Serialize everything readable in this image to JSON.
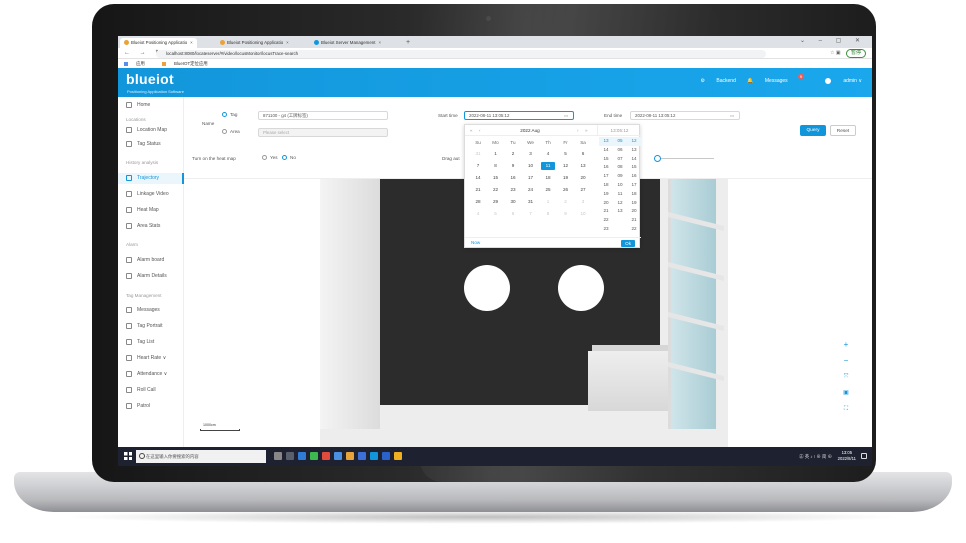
{
  "browser": {
    "tabs": [
      {
        "label": "Blueiot Positioning Applicatio",
        "active": true
      },
      {
        "label": "Blueiot Positioning Applicatio",
        "active": false
      },
      {
        "label": "Blueiot Server Management",
        "active": false
      }
    ],
    "url": "localhost:8080/locateserver/#/video/locusMonitor/locusTrace-search",
    "bookmarks": [
      "应用",
      "BlueIOT定位应用"
    ],
    "account_pill": "暂停"
  },
  "app": {
    "logo": "blueiot",
    "logo_subtitle": "Positioning Application Software",
    "header": {
      "backend": "Backend",
      "messages": "Messages",
      "message_badge": "9",
      "user": "admin"
    }
  },
  "sidebar": {
    "items": [
      {
        "label": "Home",
        "group": null
      },
      {
        "label": "Location Map",
        "group": "Locations"
      },
      {
        "label": "Tag Status",
        "group": "Locations"
      },
      {
        "label": "Trajectory",
        "group": "History analysis",
        "active": true
      },
      {
        "label": "Linkage Video",
        "group": "History analysis"
      },
      {
        "label": "Heat Map",
        "group": "History analysis"
      },
      {
        "label": "Area Stats",
        "group": "History analysis"
      },
      {
        "label": "Alarm board",
        "group": "Alarm"
      },
      {
        "label": "Alarm Details",
        "group": "Alarm"
      },
      {
        "label": "Messages",
        "group": "Tag Management"
      },
      {
        "label": "Tag Portrait",
        "group": "Tag Management"
      },
      {
        "label": "Tag List",
        "group": "Tag Management"
      },
      {
        "label": "Heart Rate ∨",
        "group": "Tag Management"
      },
      {
        "label": "Attendance ∨",
        "group": "Tag Management"
      },
      {
        "label": "Roll Call",
        "group": "Tag Management"
      },
      {
        "label": "Patrol",
        "group": "Tag Management"
      }
    ],
    "groups": [
      "Locations",
      "History analysis",
      "Alarm",
      "Tag Management"
    ]
  },
  "query": {
    "name_label": "Name",
    "tag_option": "Tag",
    "area_option": "Area",
    "tag_value": "871100 - g4 (工牌标签)",
    "area_placeholder": "Please select",
    "start_label": "Start time",
    "start_value": "2022-08-11 13:05:12",
    "end_label": "End time",
    "end_value": "2022-08-11 13:05:12",
    "heatmap_label": "Turn on the heat map",
    "yes": "Yes",
    "no": "No",
    "drag_label": "Drag aut",
    "query_button": "Query",
    "reset_button": "Reset"
  },
  "picker": {
    "title": "2022  Aug",
    "time_header": "13:05:12",
    "weekdays": [
      "Su",
      "Mo",
      "Tu",
      "We",
      "Th",
      "Fr",
      "Sa"
    ],
    "weeks": [
      [
        "31",
        "1",
        "2",
        "3",
        "4",
        "5",
        "6"
      ],
      [
        "7",
        "8",
        "9",
        "10",
        "11",
        "12",
        "13"
      ],
      [
        "14",
        "15",
        "16",
        "17",
        "18",
        "19",
        "20"
      ],
      [
        "21",
        "22",
        "23",
        "24",
        "25",
        "26",
        "27"
      ],
      [
        "28",
        "29",
        "30",
        "31",
        "1",
        "2",
        "3"
      ],
      [
        "4",
        "5",
        "6",
        "7",
        "8",
        "9",
        "10"
      ]
    ],
    "selected_day": "11",
    "hours": [
      "13",
      "14",
      "15",
      "16",
      "17",
      "18",
      "19",
      "20",
      "21",
      "22",
      "23"
    ],
    "minutes": [
      "05",
      "06",
      "07",
      "08",
      "09",
      "10",
      "11",
      "12",
      "13"
    ],
    "seconds": [
      "12",
      "13",
      "14",
      "15",
      "16",
      "17",
      "18",
      "19",
      "20",
      "21",
      "22"
    ],
    "now": "Now",
    "ok": "Ok"
  },
  "map": {
    "scale_label": "1000cm"
  },
  "taskbar": {
    "search_placeholder": "在这里输入你要搜索的内容",
    "tray": "㊣ 英 ♪ ⁝ ⊕ 简 ⊕",
    "time": "13:05",
    "date": "2022/8/11"
  }
}
